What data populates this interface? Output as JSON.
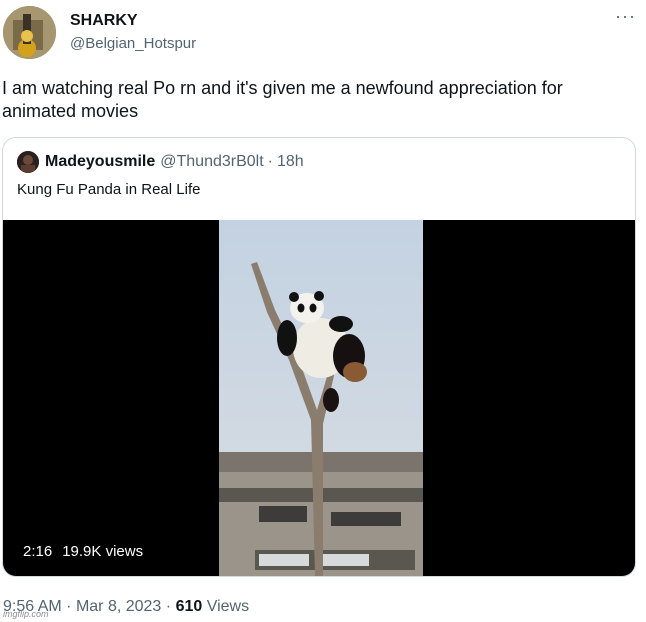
{
  "author": {
    "name": "SHARKY",
    "handle": "@Belgian_Hotspur"
  },
  "more_label": "···",
  "tweet_text": "I am watching real Po rn and it's given me a newfound appreciation for animated movies",
  "quote": {
    "name": "Madeyousmile",
    "handle": "@Thund3rB0lt",
    "separator": "·",
    "time": "18h",
    "text": "Kung Fu Panda in Real Life",
    "video": {
      "duration": "2:16",
      "views": "19.9K views"
    }
  },
  "footer": {
    "time": "9:56 AM",
    "sep1": "·",
    "date": "Mar 8, 2023",
    "sep2": "·",
    "views_count": "610",
    "views_label": "Views"
  },
  "watermark": "imgflip.com"
}
